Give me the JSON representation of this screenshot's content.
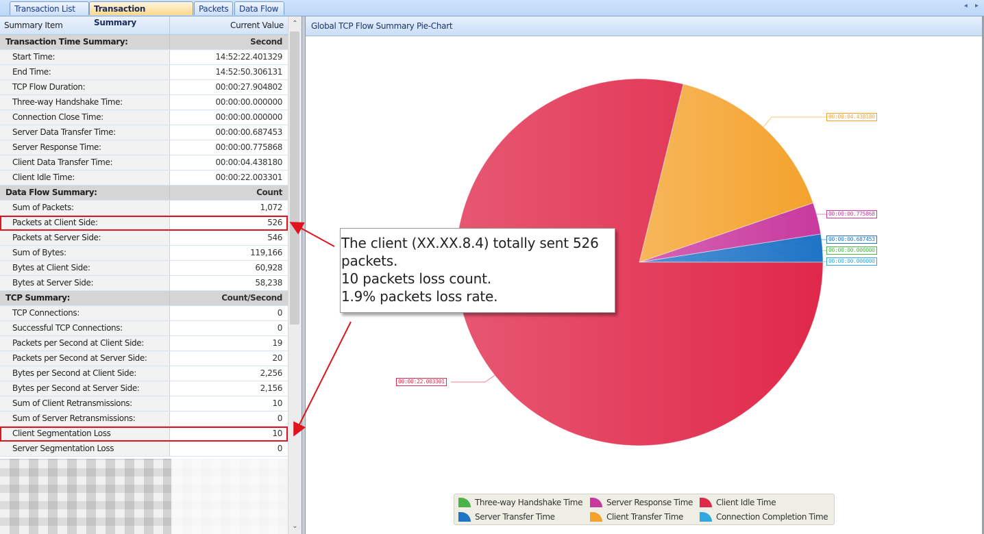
{
  "tabs": [
    {
      "label": "Transaction List",
      "active": false
    },
    {
      "label": "Transaction Summary",
      "active": true
    },
    {
      "label": "Packets",
      "active": false
    },
    {
      "label": "Data Flow",
      "active": false
    }
  ],
  "tab_scroll_icons": "◂ ▸",
  "summary_grid": {
    "columns": [
      "Summary Item",
      "Current Value"
    ],
    "rows": [
      {
        "type": "group",
        "item": "Transaction Time Summary:",
        "value": "Second"
      },
      {
        "type": "row",
        "item": "Start Time:",
        "value": "14:52:22.401329"
      },
      {
        "type": "row",
        "item": "End Time:",
        "value": "14:52:50.306131"
      },
      {
        "type": "row",
        "item": "TCP Flow Duration:",
        "value": "00:00:27.904802"
      },
      {
        "type": "row",
        "item": "Three-way Handshake Time:",
        "value": "00:00:00.000000"
      },
      {
        "type": "row",
        "item": "Connection Close Time:",
        "value": "00:00:00.000000"
      },
      {
        "type": "row",
        "item": "Server Data Transfer Time:",
        "value": "00:00:00.687453"
      },
      {
        "type": "row",
        "item": "Server Response Time:",
        "value": "00:00:00.775868"
      },
      {
        "type": "row",
        "item": "Client Data Transfer Time:",
        "value": "00:00:04.438180"
      },
      {
        "type": "row",
        "item": "Client Idle Time:",
        "value": "00:00:22.003301"
      },
      {
        "type": "group",
        "item": "Data Flow Summary:",
        "value": "Count"
      },
      {
        "type": "row",
        "item": "Sum of Packets:",
        "value": "1,072"
      },
      {
        "type": "row",
        "item": "Packets at Client Side:",
        "value": "526",
        "highlighted": true
      },
      {
        "type": "row",
        "item": "Packets at Server Side:",
        "value": "546"
      },
      {
        "type": "row",
        "item": "Sum of Bytes:",
        "value": "119,166"
      },
      {
        "type": "row",
        "item": "Bytes at Client Side:",
        "value": "60,928"
      },
      {
        "type": "row",
        "item": "Bytes at Server Side:",
        "value": "58,238"
      },
      {
        "type": "group",
        "item": "TCP Summary:",
        "value": "Count/Second"
      },
      {
        "type": "row",
        "item": "TCP Connections:",
        "value": "0"
      },
      {
        "type": "row",
        "item": "Successful TCP Connections:",
        "value": "0"
      },
      {
        "type": "row",
        "item": "Packets per Second at Client Side:",
        "value": "19"
      },
      {
        "type": "row",
        "item": "Packets per Second at Server Side:",
        "value": "20"
      },
      {
        "type": "row",
        "item": "Bytes per Second at Client Side:",
        "value": "2,256"
      },
      {
        "type": "row",
        "item": "Bytes per Second at Server Side:",
        "value": "2,156"
      },
      {
        "type": "row",
        "item": "Sum of Client Retransmissions:",
        "value": "10"
      },
      {
        "type": "row",
        "item": "Sum of Server Retransmissions:",
        "value": "0"
      },
      {
        "type": "row",
        "item": "Client Segmentation Loss",
        "value": "10",
        "highlighted": true
      },
      {
        "type": "row",
        "item": "Server Segmentation Loss",
        "value": "0"
      }
    ]
  },
  "chart_panel": {
    "title": "Global TCP Flow Summary Pie-Chart"
  },
  "chart_data": {
    "type": "pie",
    "title": "Global TCP Flow Summary Pie-Chart",
    "start_angle_deg": 0,
    "direction": "counter-clockwise",
    "slices": [
      {
        "name": "Connection Completion Time",
        "value": 0.0,
        "label": "00:00:00.000000",
        "color": "#2fa8e0"
      },
      {
        "name": "Three-way Handshake Time",
        "value": 0.0,
        "label": "00:00:00.000000",
        "color": "#4cb34a"
      },
      {
        "name": "Server Transfer Time",
        "value": 0.687453,
        "label": "00:00:00.687453",
        "color": "#1f74c6"
      },
      {
        "name": "Server Response Time",
        "value": 0.775868,
        "label": "00:00:00.775868",
        "color": "#c8399e"
      },
      {
        "name": "Client Transfer Time",
        "value": 4.43818,
        "label": "00:00:04.438180",
        "color": "#f4a22c"
      },
      {
        "name": "Client Idle Time",
        "value": 22.003301,
        "label": "00:00:22.003301",
        "color": "#e0284a"
      }
    ],
    "legend": {
      "placement": "bottom",
      "entries": [
        {
          "name": "Three-way Handshake Time",
          "color": "#4cb34a"
        },
        {
          "name": "Server Response Time",
          "color": "#c8399e"
        },
        {
          "name": "Client Idle Time",
          "color": "#e0284a"
        },
        {
          "name": "Server Transfer Time",
          "color": "#1f74c6"
        },
        {
          "name": "Client Transfer Time",
          "color": "#f4a22c"
        },
        {
          "name": "Connection Completion Time",
          "color": "#2fa8e0"
        }
      ]
    }
  },
  "annotation": {
    "lines": [
      "The client (XX.XX.8.4) totally sent 526",
      "packets.",
      "10 packets loss count.",
      "1.9% packets loss rate."
    ],
    "arrow_color": "#e0141e"
  }
}
